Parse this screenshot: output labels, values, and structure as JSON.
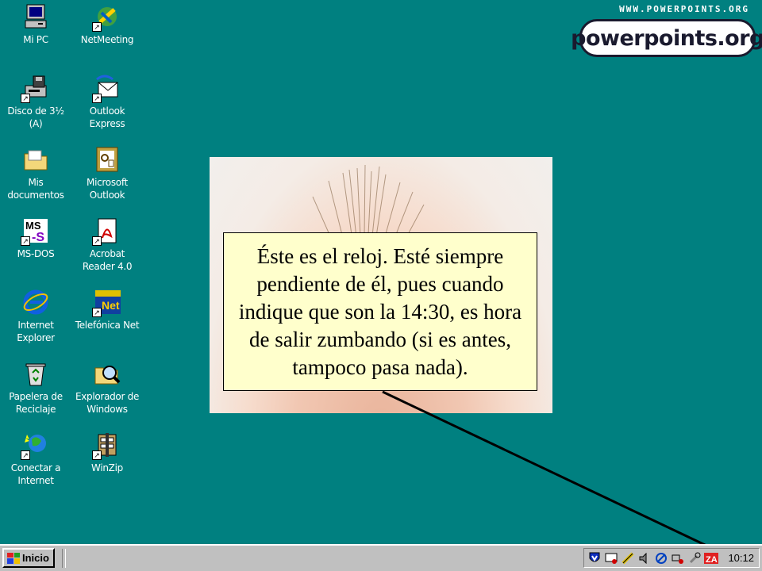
{
  "desktop": {
    "icons": [
      {
        "label": "Mi PC"
      },
      {
        "label": "NetMeeting"
      },
      {
        "label": "Disco de 3½ (A)"
      },
      {
        "label": "Outlook Express"
      },
      {
        "label": "Mis documentos"
      },
      {
        "label": "Microsoft Outlook"
      },
      {
        "label": "MS-DOS"
      },
      {
        "label": "Acrobat Reader 4.0"
      },
      {
        "label": "Internet Explorer"
      },
      {
        "label": "Telefónica Net"
      },
      {
        "label": "Papelera de Reciclaje"
      },
      {
        "label": "Explorador de Windows"
      },
      {
        "label": "Conectar a Internet"
      },
      {
        "label": "WinZip"
      }
    ]
  },
  "logo": {
    "url": "WWW.POWERPOINTS.ORG",
    "name": "powerpoints.org"
  },
  "callout": {
    "text": "Éste es el reloj. Esté siempre pendiente de él, pues cuando indique que son la 14:30, es hora de salir zumbando (si es antes, tampoco pasa nada)."
  },
  "taskbar": {
    "start_label": "Inicio",
    "clock": "10:12"
  },
  "colors": {
    "desktop": "#008080",
    "taskbar": "#c0c0c0",
    "callout_bg": "#ffffcc"
  }
}
